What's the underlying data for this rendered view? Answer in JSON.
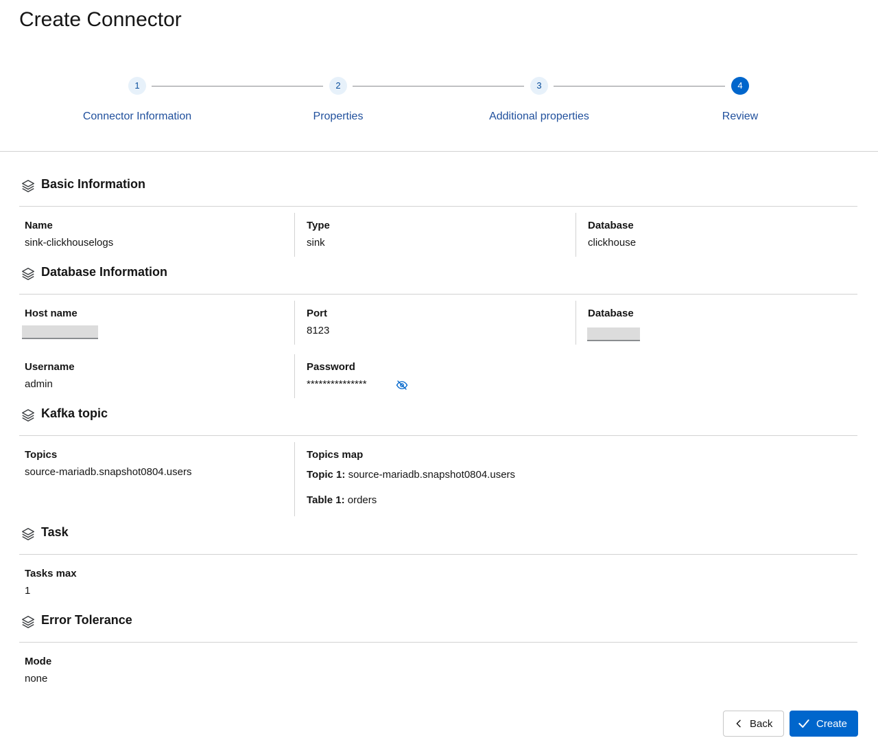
{
  "page": {
    "title": "Create Connector"
  },
  "wizard": {
    "steps": [
      {
        "number": "1",
        "label": "Connector Information"
      },
      {
        "number": "2",
        "label": "Properties"
      },
      {
        "number": "3",
        "label": "Additional properties"
      },
      {
        "number": "4",
        "label": "Review"
      }
    ],
    "current_step": 4
  },
  "basic_info": {
    "title": "Basic Information",
    "name_label": "Name",
    "name_value": "sink-clickhouselogs",
    "type_label": "Type",
    "type_value": "sink",
    "database_label": "Database",
    "database_value": "clickhouse"
  },
  "database_info": {
    "title": "Database Information",
    "host_label": "Host name",
    "port_label": "Port",
    "port_value": "8123",
    "database_label": "Database",
    "username_label": "Username",
    "username_value": "admin",
    "password_label": "Password",
    "password_value": "***************"
  },
  "kafka_topic": {
    "title": "Kafka topic",
    "topics_label": "Topics",
    "topics_value": "source-mariadb.snapshot0804.users",
    "topics_map_label": "Topics map",
    "topic1_key": "Topic 1:",
    "topic1_value": "source-mariadb.snapshot0804.users",
    "table1_key": "Table 1:",
    "table1_value": "orders"
  },
  "task": {
    "title": "Task",
    "tasks_max_label": "Tasks max",
    "tasks_max_value": "1"
  },
  "error_tolerance": {
    "title": "Error Tolerance",
    "mode_label": "Mode",
    "mode_value": "none"
  },
  "footer": {
    "back_label": "Back",
    "create_label": "Create"
  },
  "colors": {
    "primary": "#0066cc",
    "step_bg": "#e7f1fa",
    "label_blue": "#1f4f9c",
    "divider": "#d2d2d2"
  },
  "icons": {
    "section": "layers-icon",
    "password_toggle": "eye-slash-icon",
    "back": "chevron-left-icon",
    "create": "check-icon"
  }
}
